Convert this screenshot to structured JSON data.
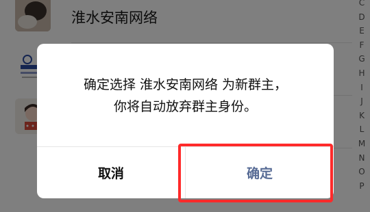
{
  "contacts": [
    {
      "name": "淮水安南网络"
    },
    {
      "name": ""
    },
    {
      "name": ""
    }
  ],
  "alpha_index": [
    "C",
    "D",
    "E",
    "F",
    "G",
    "H",
    "I",
    "J",
    "K",
    "L",
    "M",
    "N",
    "O",
    "P"
  ],
  "dialog": {
    "message_line1": "确定选择 淮水安南网络 为新群主，",
    "message_line2": "你将自动放弃群主身份。",
    "cancel_label": "取消",
    "confirm_label": "确定"
  },
  "colors": {
    "confirm_text": "#576b95",
    "highlight_border": "#ff2a2a",
    "mask": "rgba(0,0,0,0.5)"
  }
}
